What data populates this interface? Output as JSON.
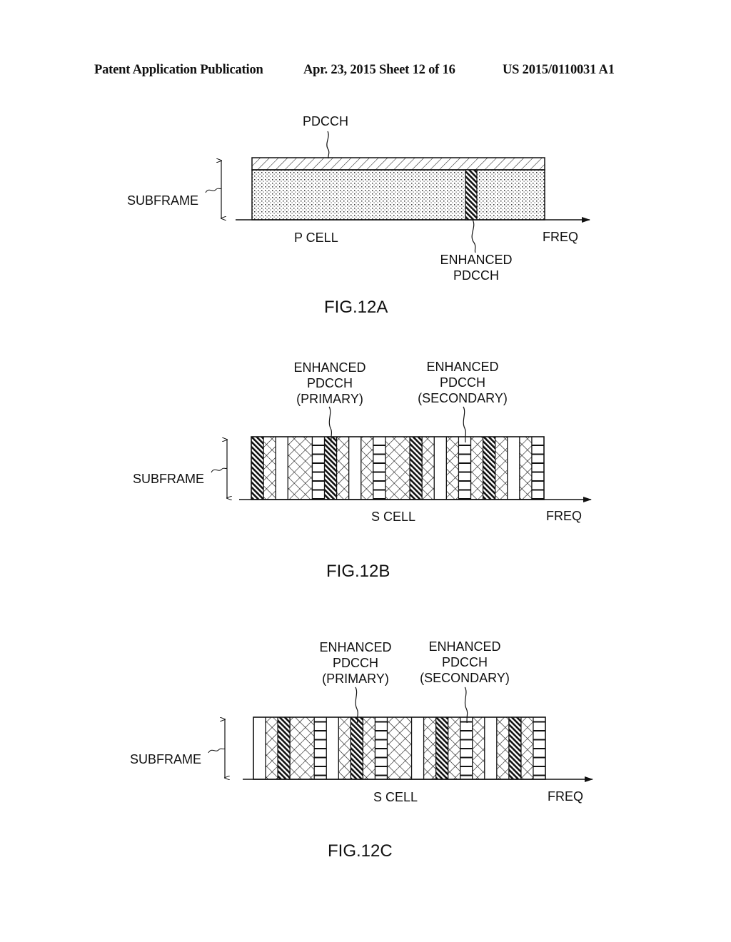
{
  "header": {
    "publication": "Patent Application Publication",
    "date_sheet": "Apr. 23, 2015  Sheet 12 of 16",
    "number": "US 2015/0110031 A1"
  },
  "figures": [
    {
      "id": "12A",
      "caption": "FIG.12A",
      "subframe_label": "SUBFRAME",
      "axis_label": "FREQ",
      "cell_label": "P CELL",
      "callouts": {
        "pdcch": "PDCCH",
        "enhanced_line1": "ENHANCED",
        "enhanced_line2": "PDCCH"
      },
      "pdcch_band_fraction": 0.2,
      "enhanced_pdcch_position_fraction": [
        0.729,
        0.768
      ]
    },
    {
      "id": "12B",
      "caption": "FIG.12B",
      "subframe_label": "SUBFRAME",
      "axis_label": "FREQ",
      "cell_label": "S CELL",
      "callouts": {
        "primary": [
          "ENHANCED",
          "PDCCH",
          "(PRIMARY)"
        ],
        "secondary": [
          "ENHANCED",
          "PDCCH",
          "(SECONDARY)"
        ]
      },
      "columns": [
        "diag",
        "cross",
        "white",
        "cross",
        "cross",
        "ladder",
        "diag",
        "cross",
        "white",
        "cross",
        "ladder",
        "cross",
        "cross",
        "diag",
        "cross",
        "white",
        "cross",
        "ladder",
        "cross",
        "diag",
        "cross",
        "white",
        "cross",
        "ladder"
      ],
      "primary_index": 6,
      "secondary_index": 17
    },
    {
      "id": "12C",
      "caption": "FIG.12C",
      "subframe_label": "SUBFRAME",
      "axis_label": "FREQ",
      "cell_label": "S CELL",
      "callouts": {
        "primary": [
          "ENHANCED",
          "PDCCH",
          "(PRIMARY)"
        ],
        "secondary": [
          "ENHANCED",
          "PDCCH",
          "(SECONDARY)"
        ]
      },
      "columns": [
        "white",
        "cross",
        "diag",
        "cross",
        "cross",
        "ladder",
        "white",
        "cross",
        "diag",
        "cross",
        "ladder",
        "cross",
        "cross",
        "white",
        "cross",
        "diag",
        "cross",
        "ladder",
        "cross",
        "white",
        "cross",
        "diag",
        "cross",
        "ladder"
      ],
      "primary_index": 8,
      "secondary_index": 17
    }
  ],
  "legend_patterns": {
    "diag": "dark diagonal hatch (enhanced PDCCH)",
    "cross": "cross-hatch",
    "white": "blank",
    "ladder": "horizontal-line ladder",
    "dots": "dotted (data region)",
    "light-diag": "light diagonal hatch (PDCCH)"
  }
}
